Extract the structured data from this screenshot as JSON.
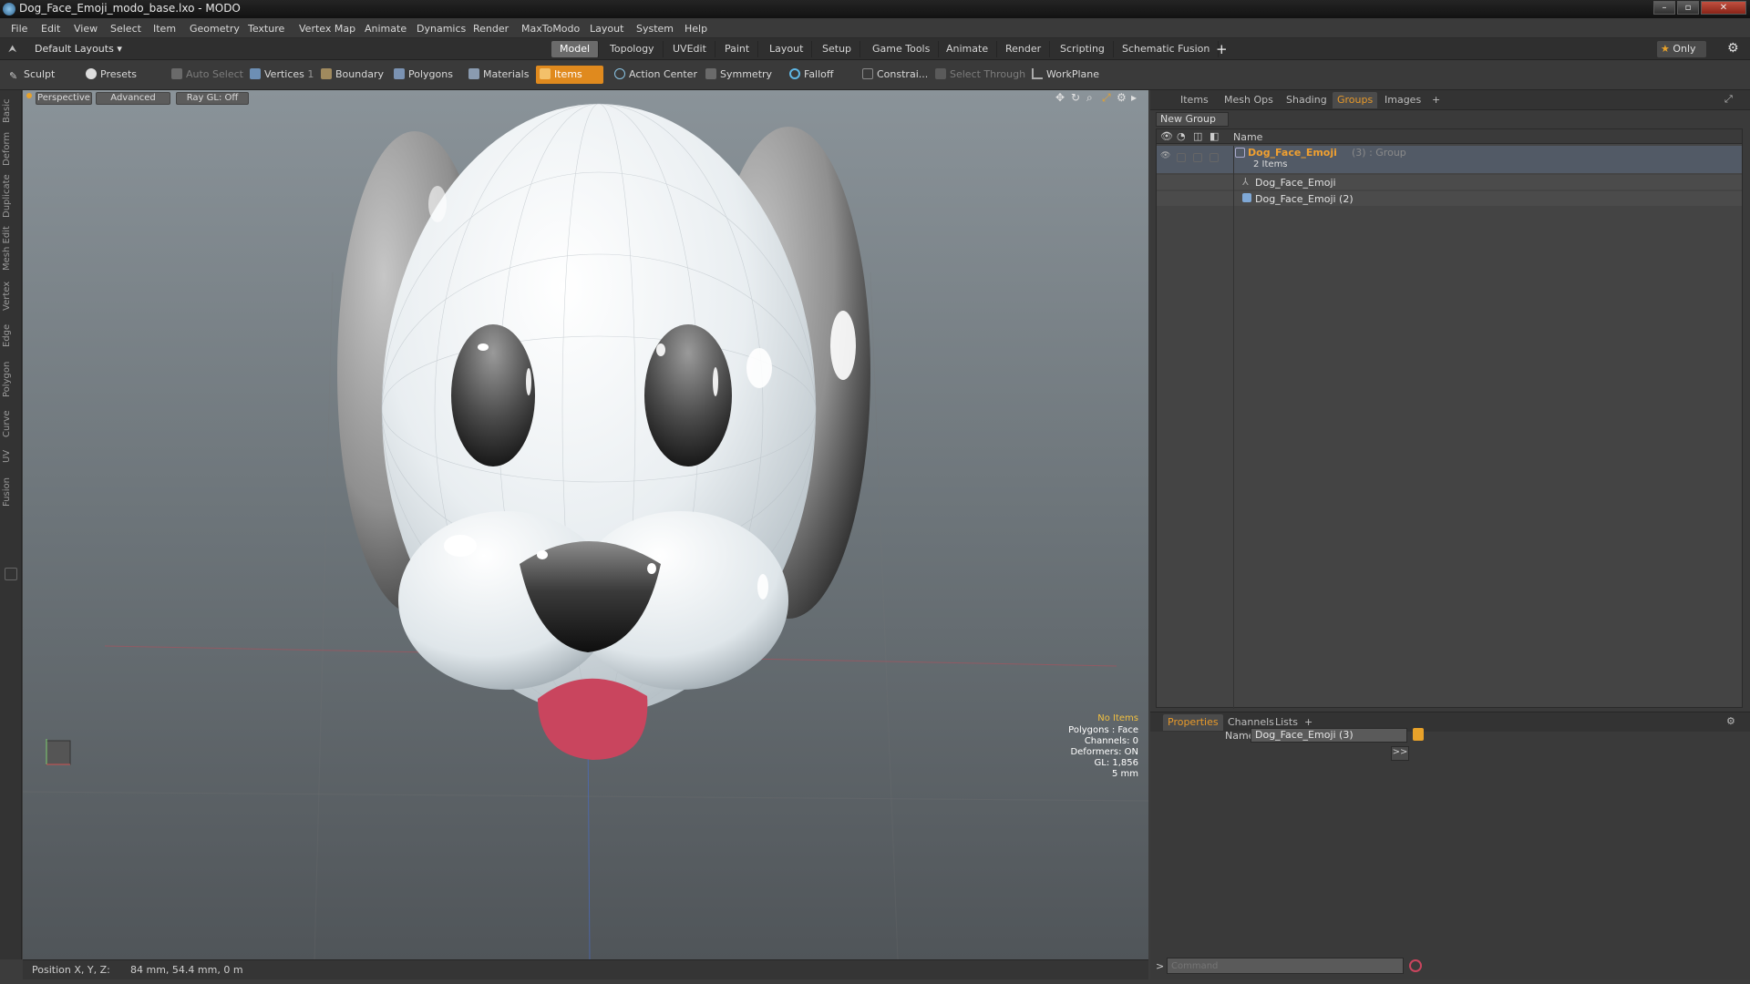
{
  "window": {
    "title": "Dog_Face_Emoji_modo_base.lxo - MODO",
    "controls": [
      "–",
      "▫",
      "✕"
    ]
  },
  "menu": [
    "File",
    "Edit",
    "View",
    "Select",
    "Item",
    "Geometry",
    "Texture",
    "Vertex Map",
    "Animate",
    "Dynamics",
    "Render",
    "MaxToModo",
    "Layout",
    "System",
    "Help"
  ],
  "layout_bar": {
    "layout_name": "Default Layouts",
    "tabs": [
      "Model",
      "Topology",
      "UVEdit",
      "Paint",
      "Layout",
      "Setup",
      "Game Tools",
      "Animate",
      "Render",
      "Scripting",
      "Schematic Fusion"
    ],
    "active_tab": "Model",
    "add": "+",
    "only_label": "Only"
  },
  "toolbar": {
    "sculpt": "Sculpt",
    "presets": "Presets",
    "auto_select": "Auto Select",
    "vertices": "Vertices",
    "vertices_count": "1",
    "boundary": "Boundary",
    "polygons": "Polygons",
    "materials": "Materials",
    "items": "Items",
    "action_center": "Action Center",
    "symmetry": "Symmetry",
    "falloff": "Falloff",
    "constrain": "Constrai...",
    "select_through": "Select Through",
    "workplane": "WorkPlane"
  },
  "left_tabs": [
    "Basic",
    "Deform",
    "Duplicate",
    "Mesh Edit",
    "Vertex",
    "Edge",
    "Polygon",
    "Curve",
    "UV",
    "Fusion"
  ],
  "viewport": {
    "view_mode": "Perspective",
    "shading": "Advanced",
    "raygl": "Ray GL: Off",
    "stats": {
      "selection": "No Items",
      "polygons": "Polygons : Face",
      "channels": "Channels: 0",
      "deformers": "Deformers: ON",
      "gl": "GL: 1,856",
      "scale": "5 mm"
    },
    "colors": {
      "accent": "#e89a2a",
      "tongue": "#c9455e",
      "face": "#f1f4f6",
      "dark": "#3a3a3a"
    }
  },
  "status_bar": {
    "position_label": "Position X, Y, Z:",
    "position_value": "84 mm, 54.4 mm, 0 m"
  },
  "right_panel": {
    "tabs": [
      "Items",
      "Mesh Ops",
      "Shading",
      "Groups",
      "Images",
      "+"
    ],
    "active_tab": "Groups",
    "new_group": "New Group",
    "column_name": "Name",
    "groups": [
      {
        "name": "Dog_Face_Emoji",
        "suffix": "(3) : Group",
        "count": "2 Items",
        "children": [
          {
            "name": "Dog_Face_Emoji",
            "icon": "locator-icon"
          },
          {
            "name": "Dog_Face_Emoji (2)",
            "icon": "mesh-icon"
          }
        ]
      }
    ]
  },
  "properties": {
    "tabs": [
      "Properties",
      "Channels",
      "Lists",
      "+"
    ],
    "active_tab": "Properties",
    "name_label": "Name",
    "name_value": "Dog_Face_Emoji (3)",
    "expand": ">>"
  },
  "command": {
    "prompt": ">",
    "placeholder": "Command"
  }
}
